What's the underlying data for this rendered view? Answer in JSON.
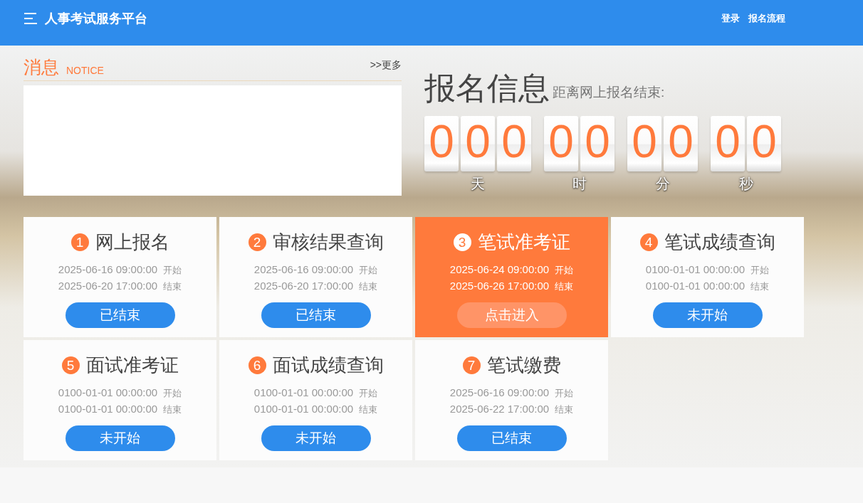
{
  "header": {
    "title": "人事考试服务平台",
    "links": [
      "登录",
      "报名流程"
    ]
  },
  "notice": {
    "title": "消息",
    "subtitle": "NOTICE",
    "more": ">>更多"
  },
  "registration": {
    "title": "报名信息",
    "subtitle": "距离网上报名结束:",
    "countdown": [
      {
        "digits": [
          "0",
          "0",
          "0"
        ],
        "unit": "天"
      },
      {
        "digits": [
          "0",
          "0"
        ],
        "unit": "时"
      },
      {
        "digits": [
          "0",
          "0"
        ],
        "unit": "分"
      },
      {
        "digits": [
          "0",
          "0"
        ],
        "unit": "秒"
      }
    ]
  },
  "steps": [
    {
      "number": "1",
      "title": "网上报名",
      "start": "2025-06-16 09:00:00",
      "start_label": "开始",
      "end": "2025-06-20 17:00:00",
      "end_label": "结束",
      "button": "已结束",
      "active": false
    },
    {
      "number": "2",
      "title": "审核结果查询",
      "start": "2025-06-16 09:00:00",
      "start_label": "开始",
      "end": "2025-06-20 17:00:00",
      "end_label": "结束",
      "button": "已结束",
      "active": false
    },
    {
      "number": "3",
      "title": "笔试准考证",
      "start": "2025-06-24 09:00:00",
      "start_label": "开始",
      "end": "2025-06-26 17:00:00",
      "end_label": "结束",
      "button": "点击进入",
      "active": true
    },
    {
      "number": "4",
      "title": "笔试成绩查询",
      "start": "0100-01-01 00:00:00",
      "start_label": "开始",
      "end": "0100-01-01 00:00:00",
      "end_label": "结束",
      "button": "未开始",
      "active": false
    },
    {
      "number": "5",
      "title": "面试准考证",
      "start": "0100-01-01 00:00:00",
      "start_label": "开始",
      "end": "0100-01-01 00:00:00",
      "end_label": "结束",
      "button": "未开始",
      "active": false
    },
    {
      "number": "6",
      "title": "面试成绩查询",
      "start": "0100-01-01 00:00:00",
      "start_label": "开始",
      "end": "0100-01-01 00:00:00",
      "end_label": "结束",
      "button": "未开始",
      "active": false
    },
    {
      "number": "7",
      "title": "笔试缴费",
      "start": "2025-06-16 09:00:00",
      "start_label": "开始",
      "end": "2025-06-22 17:00:00",
      "end_label": "结束",
      "button": "已结束",
      "active": false
    }
  ]
}
